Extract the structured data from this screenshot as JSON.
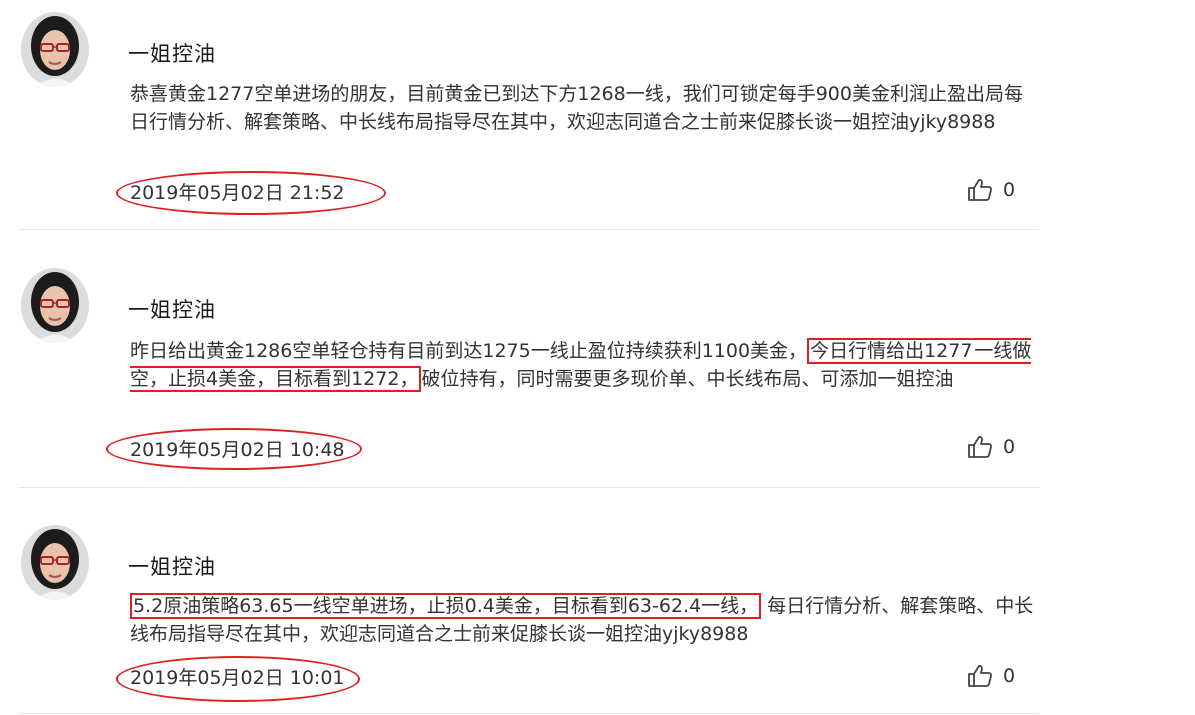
{
  "posts": [
    {
      "author": "一姐控油",
      "content_parts": [
        {
          "text": "恭喜黄金1277空单进场的朋友，目前黄金已到达下方1268一线，我们可锁定每手900美金利润止盈出局每日行情分析、解套策略、中长线布局指导尽在其中，欢迎志同道合之士前来促膝长谈一姐控油yjky8988"
        }
      ],
      "date": "2019年05月02日 21:52",
      "likes": "0"
    },
    {
      "author": "一姐控油",
      "content_parts": [
        {
          "text": "昨日给出黄金1286空单轻仓持有目前到达1275一线止盈位持续获利1100美金，"
        },
        {
          "text": "今日行情给出1277",
          "highlight": true
        },
        {
          "text": "一线做空，止损4美金，目标看到1272，",
          "highlight": true
        },
        {
          "text": "破位持有，同时需要更多现价单、中长线布局、可添加一姐控油"
        }
      ],
      "date": "2019年05月02日 10:48",
      "likes": "0"
    },
    {
      "author": "一姐控油",
      "content_parts": [
        {
          "text": "5.2原油策略63.65一线空单进场，止损0.4美金，目标看到63-62.4一线，",
          "highlight": true
        },
        {
          "text": "每日行情分析、解套策略、中长线布局指导尽在其中，欢迎志同道合之士前来促膝长谈一姐控油yjky8988"
        }
      ],
      "date": "2019年05月02日 10:01",
      "likes": "0"
    }
  ],
  "icons": {
    "like": "thumbs-up-icon",
    "avatar": "user-avatar"
  },
  "colors": {
    "highlight": "#e02020",
    "text": "#333333",
    "divider": "#e5e5e5"
  }
}
